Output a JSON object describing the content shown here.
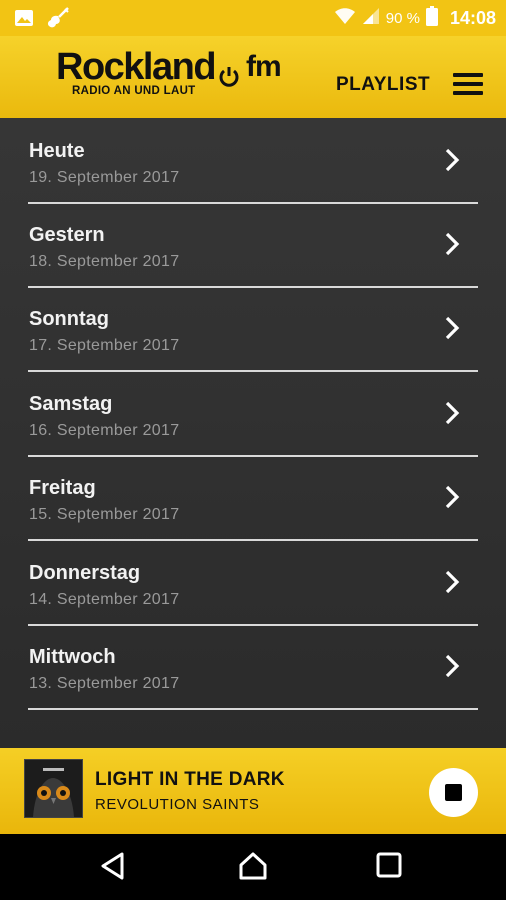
{
  "status_bar": {
    "battery_percent": "90 %",
    "time": "14:08",
    "icons": [
      "image-icon",
      "guitar-icon",
      "wifi-icon",
      "signal-icon",
      "battery-icon"
    ]
  },
  "header": {
    "logo_main": "Rockland",
    "logo_fm": "fm",
    "logo_tagline": "RADIO AN UND LAUT",
    "playlist_label": "PLAYLIST",
    "menu_icon": "menu-icon"
  },
  "days": [
    {
      "day": "Heute",
      "date": "19. September 2017"
    },
    {
      "day": "Gestern",
      "date": "18. September 2017"
    },
    {
      "day": "Sonntag",
      "date": "17. September 2017"
    },
    {
      "day": "Samstag",
      "date": "16. September 2017"
    },
    {
      "day": "Freitag",
      "date": "15. September 2017"
    },
    {
      "day": "Donnerstag",
      "date": "14. September 2017"
    },
    {
      "day": "Mittwoch",
      "date": "13. September 2017"
    }
  ],
  "player": {
    "title": "LIGHT IN THE DARK",
    "artist": "REVOLUTION SAINTS",
    "control_icon": "stop-icon"
  },
  "colors": {
    "accent": "#f2c414",
    "list_background": "#2f2f2f",
    "divider": "#d9d9d9"
  }
}
